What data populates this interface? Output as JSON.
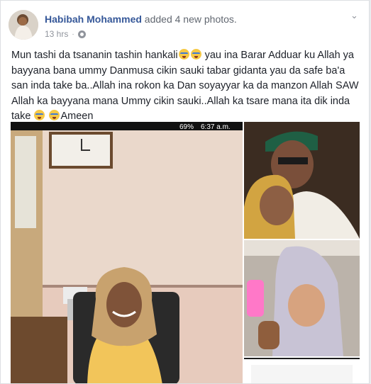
{
  "post": {
    "author": "Habibah Mohammed",
    "action": "added 4 new photos.",
    "time": "13 hrs",
    "separator": "·",
    "text_parts": [
      "Mun tashi da tsananin tashin hankali",
      " yau ina Barar Adduar ku Allah ya bayyana bana ummy Danmusa cikin sauki tabar gidanta yau da safe ba'a san inda take ba..Allah ina rokon ka Dan soyayyar ka da manzon Allah SAW Allah ka bayyana mana Ummy cikin sauki..Allah ka tsare mana ita dik inda take ",
      "Ameen"
    ]
  },
  "photo_main": {
    "status_bar": {
      "battery": "69%",
      "time": "6:37 a.m."
    }
  },
  "icons": [
    "avatar",
    "globe-icon",
    "chevron-down-icon",
    "crying-emoji-icon"
  ],
  "colors": {
    "author": "#365899",
    "meta": "#90949c",
    "text": "#1d2129",
    "border": "#dddfe2"
  }
}
